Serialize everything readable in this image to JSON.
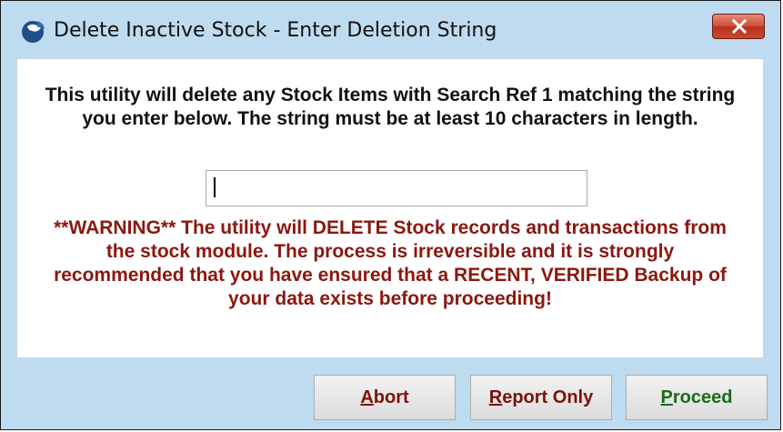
{
  "window": {
    "title": "Delete Inactive Stock - Enter Deletion String"
  },
  "content": {
    "info": "This utility will delete any Stock Items with Search Ref 1 matching the string you enter below. The string must be at least 10 characters in length.",
    "input_value": "",
    "warning": "**WARNING** The utility will DELETE Stock records and transactions from the stock module. The process is irreversible and it is strongly recommended that you have ensured that a RECENT, VERIFIED Backup of your data exists before proceeding!"
  },
  "buttons": {
    "abort": {
      "mnemonic": "A",
      "rest": "bort"
    },
    "report_only": {
      "mnemonic": "R",
      "rest": "eport Only"
    },
    "proceed": {
      "mnemonic": "P",
      "rest": "roceed"
    }
  },
  "colors": {
    "window_bg": "#bfdbf0",
    "warning_text": "#8b1710",
    "abort_text": "#7a1209",
    "proceed_text": "#1a6b1a",
    "close_button": "#c8482f"
  },
  "icons": {
    "app": "app-logo-icon",
    "close": "close-icon"
  }
}
